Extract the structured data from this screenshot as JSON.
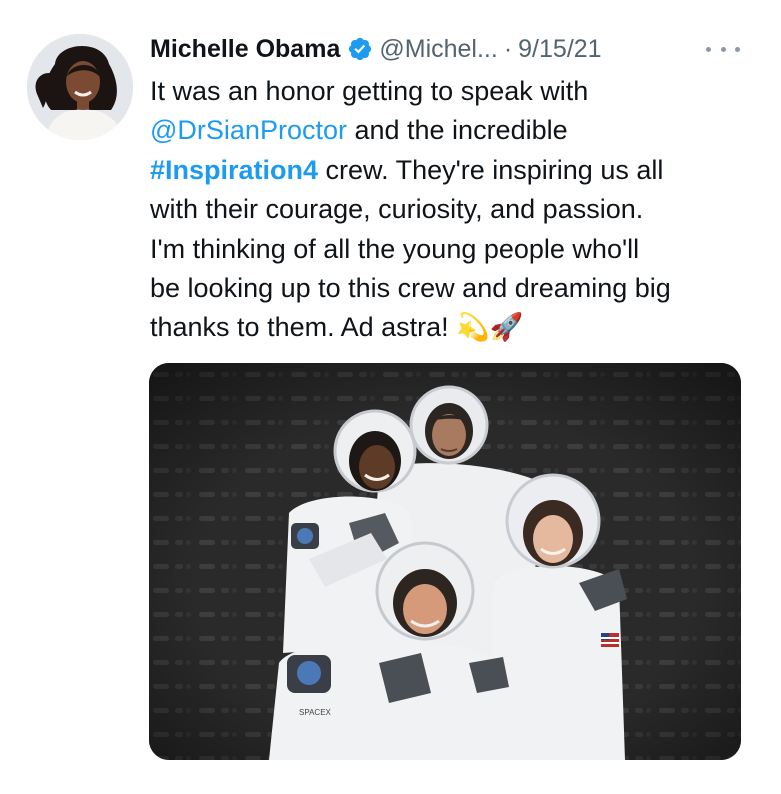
{
  "tweet": {
    "author": {
      "name": "Michelle Obama",
      "handle": "@Michel...",
      "verified": true,
      "avatar_icon": "profile-photo"
    },
    "separator": "·",
    "date": "9/15/21",
    "more_icon": "more-horizontal-icon",
    "text": {
      "line1": "It was an honor getting to speak with",
      "line2_mention": "@DrSianProctor",
      "line2_rest": " and the incredible",
      "line3_hashtag": "#Inspiration4",
      "line3_rest": " crew. They're inspiring us all",
      "line4": "with their courage, curiosity, and passion.",
      "line5": "I'm thinking of all the young people who'll",
      "line6": "be looking up to this crew and dreaming big",
      "line7": "thanks to them. Ad astra!",
      "emoji": "💫🚀"
    },
    "media": {
      "description_icon": "crew-photo",
      "suit_patch_text": "SPACEX"
    }
  },
  "colors": {
    "link": "#1d9bf0",
    "text": "#0f1419",
    "secondary": "#536471",
    "verified": "#1d9bf0",
    "photo_background": "#262626",
    "suit": "#f1f2f4"
  }
}
